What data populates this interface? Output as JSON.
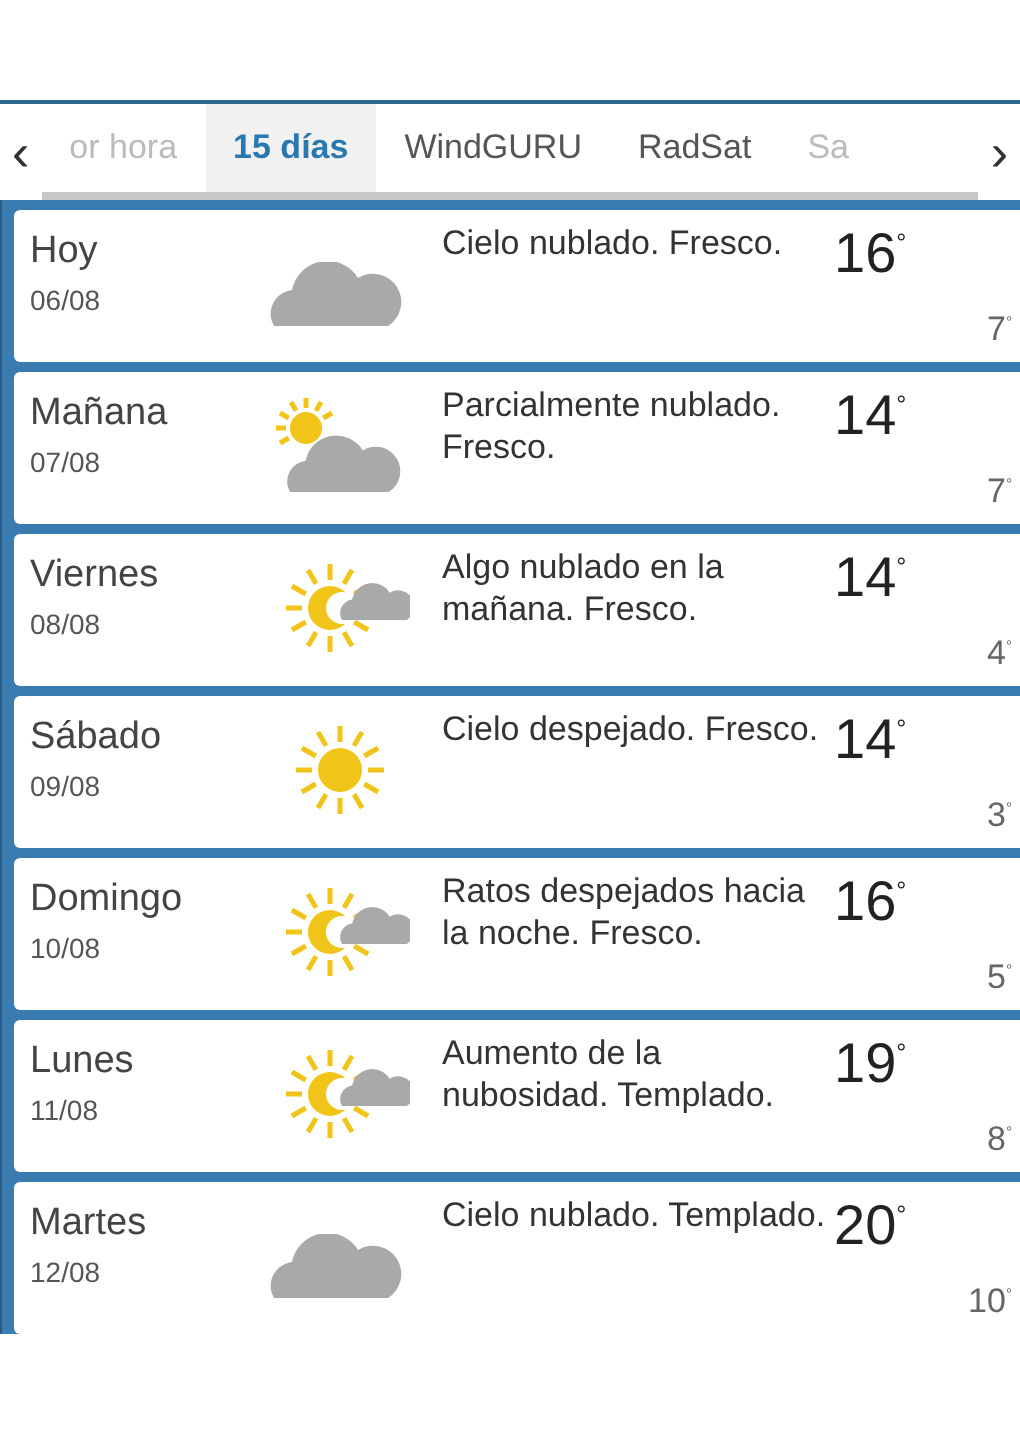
{
  "tabs": [
    {
      "label": "or hora",
      "selected": false,
      "faded": true
    },
    {
      "label": "15 días",
      "selected": true,
      "faded": false
    },
    {
      "label": "WindGURU",
      "selected": false,
      "faded": false
    },
    {
      "label": "RadSat",
      "selected": false,
      "faded": false
    },
    {
      "label": "Sa",
      "selected": false,
      "faded": true
    }
  ],
  "nav": {
    "prev": "‹",
    "next": "›"
  },
  "days": [
    {
      "day": "Hoy",
      "date": "06/08",
      "kind": "cloud",
      "description": "Cielo nublado. Fresco.",
      "max": "16$^{°}$",
      "min": "7$^{°}$"
    },
    {
      "day": "Mañana",
      "date": "07/08",
      "kind": "sun_cloud",
      "description": "Parcialmente nublado. Fresco.",
      "max": "14$^{°}$",
      "min": "7$^{°}$"
    },
    {
      "day": "Viernes",
      "date": "08/08",
      "kind": "sun_crescent_cloud",
      "description": "Algo nublado en la mañana. Fresco.",
      "max": "14$^{°}$",
      "min": "4$^{°}$"
    },
    {
      "day": "Sábado",
      "date": "09/08",
      "kind": "sun",
      "description": "Cielo despejado. Fresco.",
      "max": "14$^{°}$",
      "min": "3$^{°}$"
    },
    {
      "day": "Domingo",
      "date": "10/08",
      "kind": "sun_crescent_cloud",
      "description": "Ratos despejados hacia la noche. Fresco.",
      "max": "16$^{°}$",
      "min": "5$^{°}$"
    },
    {
      "day": "Lunes",
      "date": "11/08",
      "kind": "sun_crescent_cloud",
      "description": "Aumento de la nubosidad. Templado.",
      "max": "19$^{°}$",
      "min": "8$^{°}$"
    },
    {
      "day": "Martes",
      "date": "12/08",
      "kind": "cloud",
      "description": "Cielo nublado. Templado.",
      "max": "20$^{°}$",
      "min": "10$^{°}$"
    }
  ]
}
